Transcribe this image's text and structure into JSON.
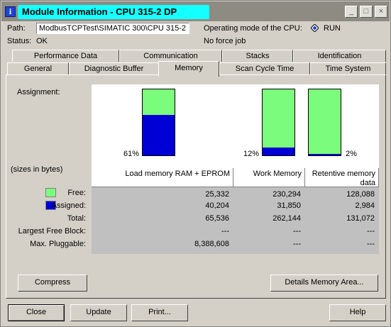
{
  "window": {
    "title": "Module Information - CPU 315-2 DP",
    "min_symbol": "_",
    "max_symbol": "□",
    "close_symbol": "×"
  },
  "info": {
    "path_label": "Path:",
    "path_value": "ModbusTCPTest\\SIMATIC 300\\CPU 315-2",
    "mode_label": "Operating mode of the  CPU:",
    "mode_value": "RUN",
    "status_label": "Status:",
    "status_value": "OK",
    "force_value": "No force job"
  },
  "tabs_top": [
    "Performance Data",
    "Communication",
    "Stacks",
    "Identification"
  ],
  "tabs_bottom": [
    "General",
    "Diagnostic Buffer",
    "Memory",
    "Scan Cycle Time",
    "Time System"
  ],
  "active_tab": "Memory",
  "memory": {
    "assignment_label": "Assignment:",
    "sizes_label": "(sizes in bytes)",
    "columns": [
      "Load memory RAM + EPROM",
      "Work Memory",
      "Retentive memory data"
    ],
    "row_labels": [
      "Free:",
      "Assigned:",
      "Total:",
      "Largest Free Block:",
      "Max. Pluggable:"
    ],
    "rows": [
      [
        "25,332",
        "230,294",
        "128,088"
      ],
      [
        "40,204",
        "31,850",
        "2,984"
      ],
      [
        "65,536",
        "262,144",
        "131,072"
      ],
      [
        "---",
        "---",
        "---"
      ],
      [
        "8,388,608",
        "---",
        "---"
      ]
    ],
    "bars": [
      {
        "label": "61%",
        "assigned_fraction": 0.61
      },
      {
        "label": "12%",
        "assigned_fraction": 0.12
      },
      {
        "label": "2%",
        "assigned_fraction": 0.02
      }
    ],
    "colors": {
      "free": "#7cfc7c",
      "assigned": "#0000d6"
    }
  },
  "buttons": {
    "compress": "Compress",
    "details": "Details Memory Area...",
    "close": "Close",
    "update": "Update",
    "print": "Print...",
    "help": "Help"
  }
}
